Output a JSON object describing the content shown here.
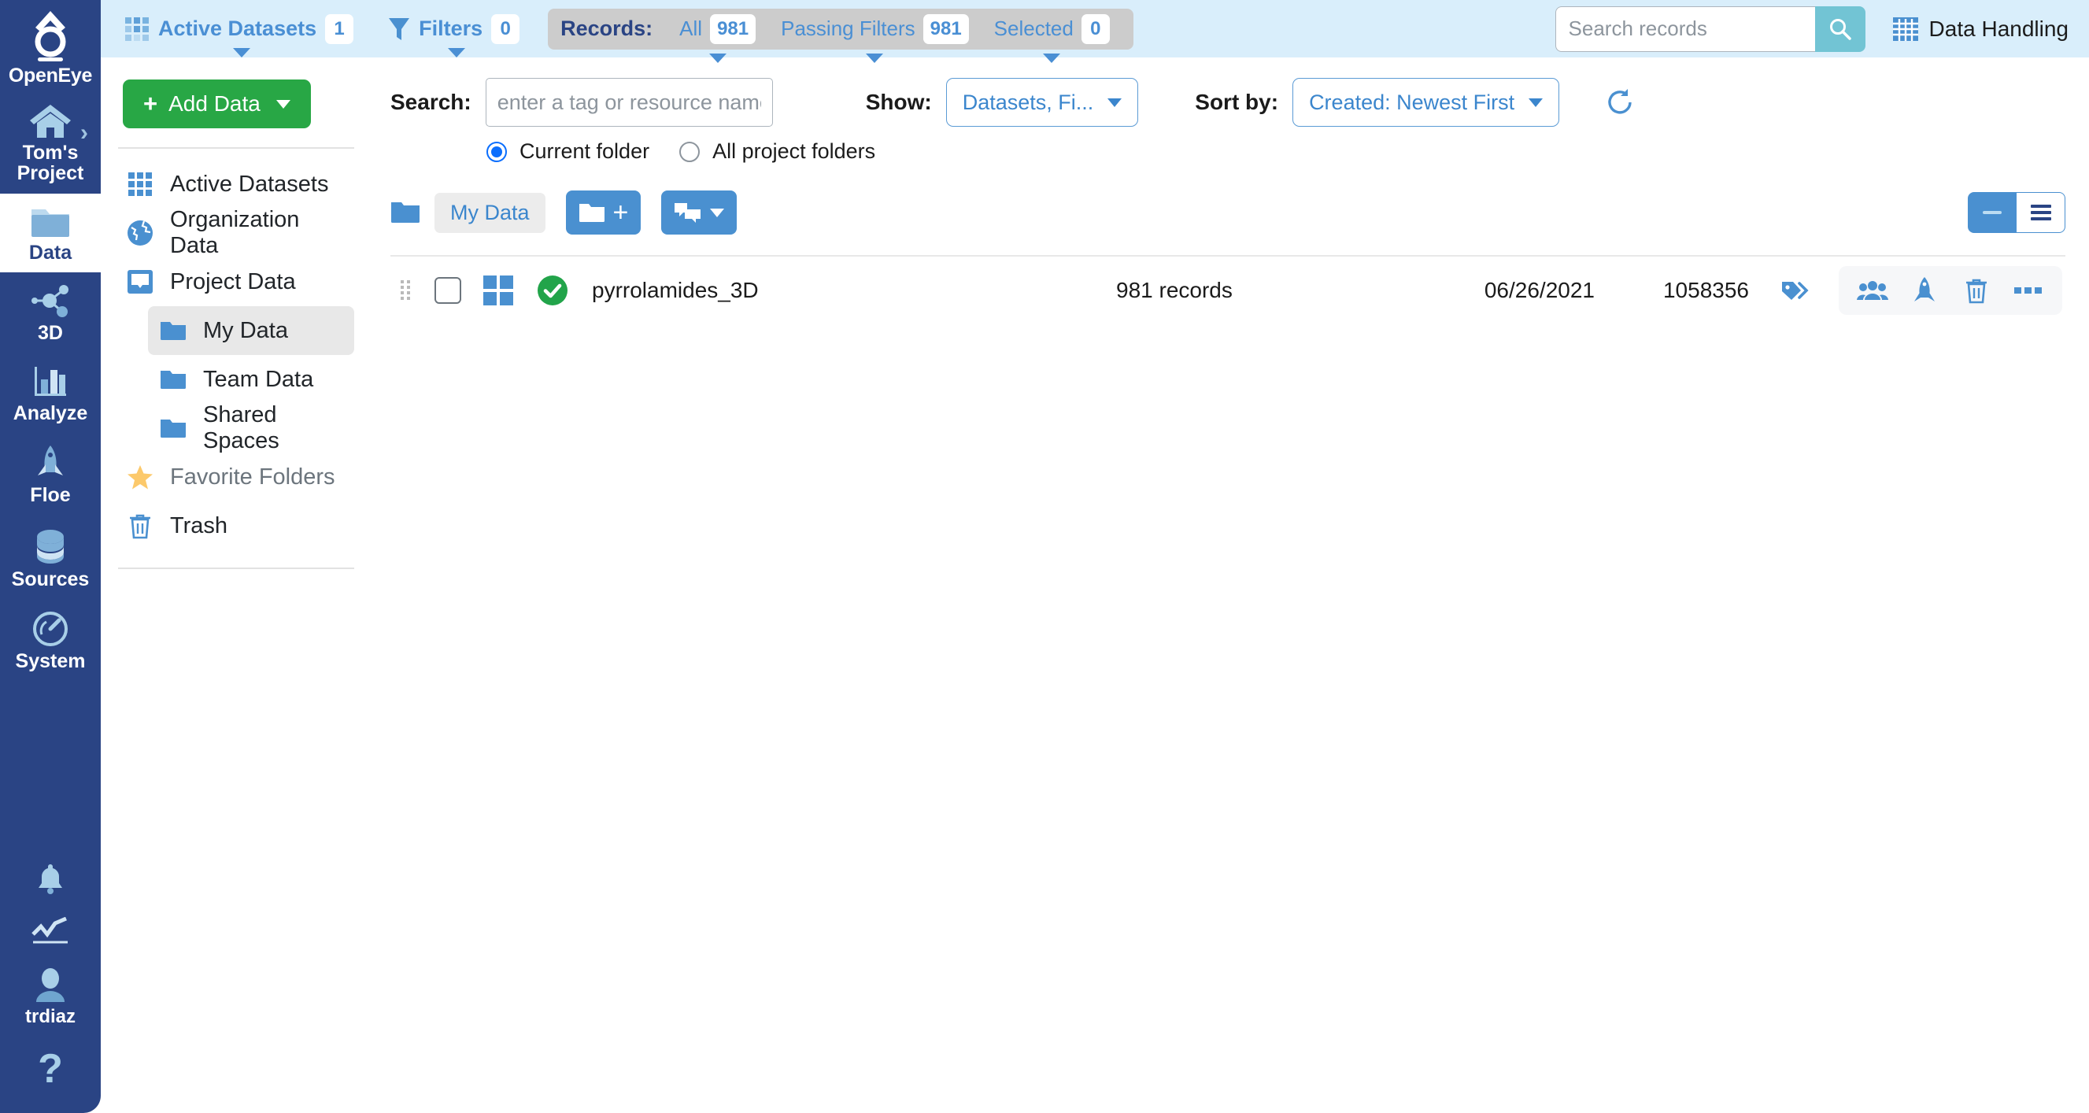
{
  "rail": {
    "brand": {
      "name": "OpenEye",
      "icon": "openeye-logo-icon"
    },
    "project": {
      "label": "Tom's Project",
      "icon": "home-icon",
      "chevron": "›"
    },
    "items": [
      {
        "label": "Data",
        "icon": "folder-icon",
        "active": true
      },
      {
        "label": "3D",
        "icon": "molecule-icon",
        "active": false
      },
      {
        "label": "Analyze",
        "icon": "bar-chart-icon",
        "active": false
      },
      {
        "label": "Floe",
        "icon": "rocket-icon",
        "active": false
      },
      {
        "label": "Sources",
        "icon": "database-icon",
        "active": false
      },
      {
        "label": "System",
        "icon": "gauge-icon",
        "active": false
      }
    ],
    "bottom": [
      {
        "label": "",
        "icon": "bell-icon"
      },
      {
        "label": "",
        "icon": "activity-line-icon"
      },
      {
        "label": "trdiaz",
        "icon": "user-avatar-icon"
      },
      {
        "label": "?",
        "icon": "help-icon"
      }
    ]
  },
  "topbar": {
    "active_datasets": {
      "label": "Active Datasets",
      "count": "1",
      "icon": "grid-icon"
    },
    "filters": {
      "label": "Filters",
      "count": "0",
      "icon": "funnel-icon"
    },
    "records": {
      "title": "Records:",
      "items": [
        {
          "label": "All",
          "count": "981"
        },
        {
          "label": "Passing Filters",
          "count": "981"
        },
        {
          "label": "Selected",
          "count": "0"
        }
      ]
    },
    "search": {
      "placeholder": "Search records",
      "value": "",
      "button_icon": "search-icon"
    },
    "data_handling": {
      "label": "Data Handling",
      "icon": "table-grid-icon"
    }
  },
  "navpanel": {
    "add_data": {
      "label": "Add Data",
      "plus": "+"
    },
    "items": [
      {
        "label": "Active Datasets",
        "icon": "grid-icon",
        "selected": false,
        "sub": false,
        "muted": false
      },
      {
        "label": "Organization Data",
        "icon": "globe-icon",
        "selected": false,
        "sub": false,
        "muted": false
      },
      {
        "label": "Project Data",
        "icon": "monitor-icon",
        "selected": false,
        "sub": false,
        "muted": false
      },
      {
        "label": "My Data",
        "icon": "folder-icon",
        "selected": true,
        "sub": true,
        "muted": false
      },
      {
        "label": "Team Data",
        "icon": "folder-icon",
        "selected": false,
        "sub": true,
        "muted": false
      },
      {
        "label": "Shared Spaces",
        "icon": "folder-icon",
        "selected": false,
        "sub": true,
        "muted": false
      },
      {
        "label": "Favorite Folders",
        "icon": "star-icon",
        "selected": false,
        "sub": false,
        "muted": true
      },
      {
        "label": "Trash",
        "icon": "trash-icon",
        "selected": false,
        "sub": false,
        "muted": false
      }
    ]
  },
  "toolbar": {
    "search_label": "Search:",
    "search_placeholder": "enter a tag or resource name...",
    "search_value": "",
    "scope": {
      "current_folder": "Current folder",
      "all_project_folders": "All project folders",
      "selected": "Current folder"
    },
    "show_label": "Show:",
    "show_value": "Datasets, Fi...",
    "sort_label": "Sort by:",
    "sort_value": "Created: Newest First",
    "refresh_icon": "refresh-icon"
  },
  "breadcrumb": {
    "folder_icon": "folder-icon",
    "current": "My Data",
    "new_folder_button": "new-folder-icon",
    "move_copy_button": "move-copy-icon"
  },
  "view_toggle": {
    "compact_icon": "collapse-rows-icon",
    "list_icon": "list-view-icon",
    "active": "compact"
  },
  "table": {
    "rows": [
      {
        "name": "pyrrolamides_3D",
        "records": "981 records",
        "date": "06/26/2021",
        "id": "1058356",
        "status": "ready",
        "checked": false
      }
    ],
    "row_actions": [
      "share-users-icon",
      "floe-rocket-icon",
      "trash-icon",
      "more-ellipsis-icon"
    ],
    "tag_icon": "tags-icon"
  },
  "colors": {
    "rail_bg": "#2a4484",
    "topbar_bg": "#d9eefb",
    "accent_blue": "#4a90d0",
    "link_blue": "#3b86cd",
    "green": "#28a745",
    "teal": "#72c4d4"
  }
}
